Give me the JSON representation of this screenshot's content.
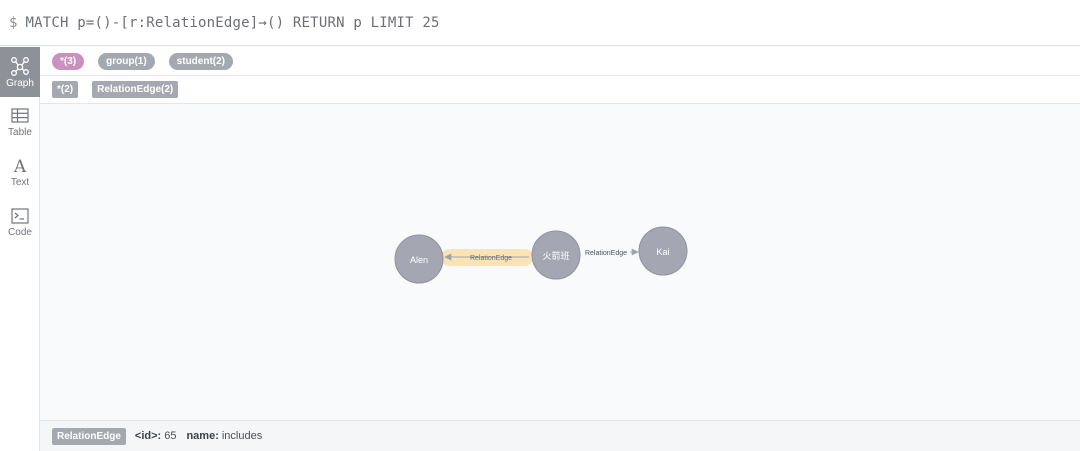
{
  "query": {
    "prompt": "$",
    "text": "MATCH p=()-[r:RelationEdge]→() RETURN p LIMIT 25"
  },
  "sidebar": {
    "items": [
      {
        "label": "Graph",
        "icon": "graph-icon",
        "active": true
      },
      {
        "label": "Table",
        "icon": "table-icon",
        "active": false
      },
      {
        "label": "Text",
        "icon": "text-icon",
        "active": false
      },
      {
        "label": "Code",
        "icon": "code-icon",
        "active": false
      }
    ]
  },
  "node_labels": [
    {
      "label": "*(3)",
      "color": "#c990c0"
    },
    {
      "label": "group(1)",
      "color": "#a4a9b0"
    },
    {
      "label": "student(2)",
      "color": "#a4a9b0"
    }
  ],
  "relationship_types": [
    {
      "label": "*(2)"
    },
    {
      "label": "RelationEdge(2)"
    }
  ],
  "graph": {
    "nodes": [
      {
        "id": "n-alen",
        "caption": "Alen",
        "color": "#a4a7b2"
      },
      {
        "id": "n-group",
        "caption": "火箭班",
        "color": "#a4a7b2"
      },
      {
        "id": "n-kai",
        "caption": "Kai",
        "color": "#a4a7b2"
      }
    ],
    "edges": [
      {
        "from": "n-group",
        "to": "n-alen",
        "caption": "RelationEdge",
        "selected": true
      },
      {
        "from": "n-group",
        "to": "n-kai",
        "caption": "RelationEdge",
        "selected": false
      }
    ],
    "highlight_color": "#fbe3b8"
  },
  "footer": {
    "type_label": "RelationEdge",
    "props": [
      {
        "key": "<id>:",
        "value": "65"
      },
      {
        "key": "name:",
        "value": "includes"
      }
    ]
  }
}
